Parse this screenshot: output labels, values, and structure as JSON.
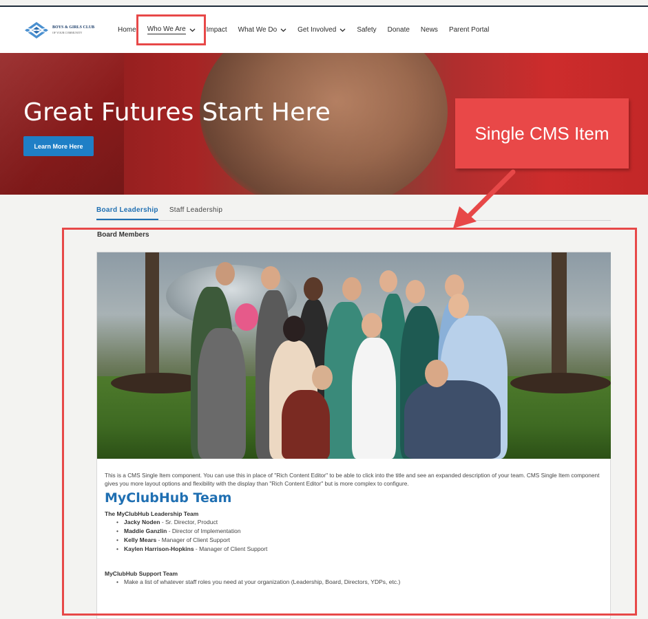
{
  "header": {
    "logo_text": "BOYS & GIRLS CLUB",
    "logo_subtext": "OF YOUR COMMUNITY",
    "nav": [
      {
        "label": "Home",
        "has_dropdown": false
      },
      {
        "label": "Who We Are",
        "has_dropdown": true,
        "active": true
      },
      {
        "label": "Impact",
        "has_dropdown": false
      },
      {
        "label": "What We Do",
        "has_dropdown": true
      },
      {
        "label": "Get Involved",
        "has_dropdown": true
      },
      {
        "label": "Safety",
        "has_dropdown": false
      },
      {
        "label": "Donate",
        "has_dropdown": false
      },
      {
        "label": "News",
        "has_dropdown": false
      },
      {
        "label": "Parent Portal",
        "has_dropdown": false
      }
    ],
    "chevron": "⌄"
  },
  "hero": {
    "title": "Great Futures Start Here",
    "button_label": "Learn More Here"
  },
  "callout": {
    "label": "Single CMS Item"
  },
  "tabs": [
    {
      "label": "Board Leadership",
      "active": true
    },
    {
      "label": "Staff Leadership",
      "active": false
    }
  ],
  "section_title": "Board Members",
  "cms_item": {
    "description": "This is a CMS Single Item component. You can use this in place of \"Rich Content Editor\" to be able to click into the title and see an expanded description of your team. CMS Single Item component gives you more layout options and flexibility with the display than \"Rich Content Editor\" but is more complex to configure.",
    "team_title": "MyClubHub Team",
    "leadership_title": "The MyClubHub Leadership Team",
    "leadership": [
      {
        "name": "Jacky Noden",
        "role": " - Sr. Director, Product"
      },
      {
        "name": "Maddie Ganzlin",
        "role": " - Director of Implementation"
      },
      {
        "name": "Kelly Mears",
        "role": " - Manager of Client Support"
      },
      {
        "name": "Kaylen Harrison-Hopkins",
        "role": " - Manager of Client Support"
      }
    ],
    "support_title": "MyClubHub Support Team",
    "support": [
      "Make a list of whatever staff roles you need at your organization (Leadership, Board, Directors, YDPs, etc.)"
    ]
  },
  "colors": {
    "accent_blue": "#1f6fb2",
    "button_blue": "#1f7fc6",
    "annotation_red": "#e74848"
  }
}
